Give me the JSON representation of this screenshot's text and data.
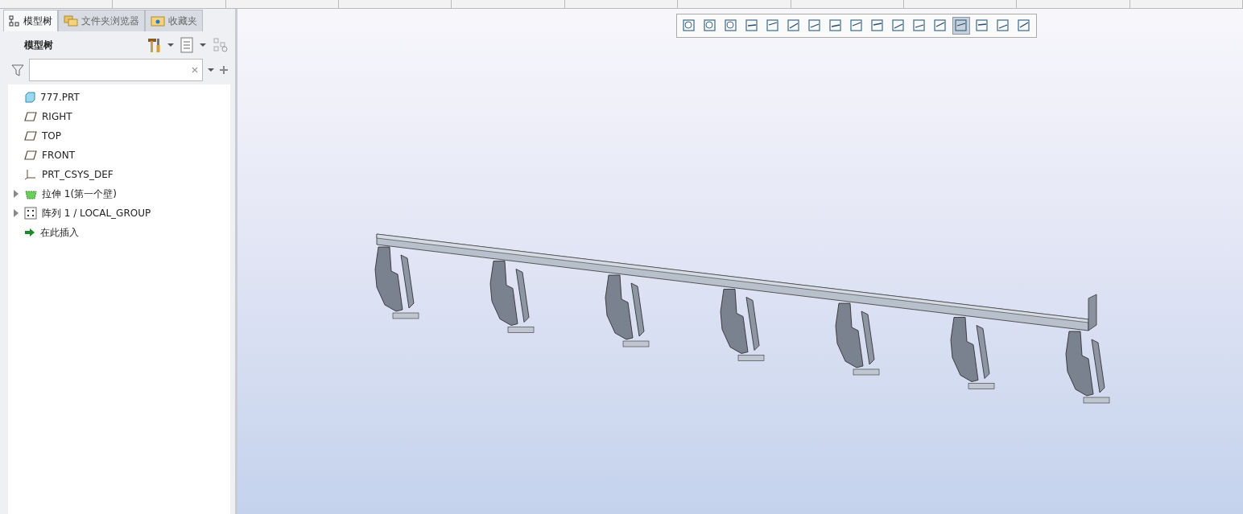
{
  "tabs": [
    {
      "label": "模型树",
      "kind": "tree",
      "selected": true
    },
    {
      "label": "文件夹浏览器",
      "kind": "folders",
      "selected": false
    },
    {
      "label": "收藏夹",
      "kind": "favorites",
      "selected": false
    }
  ],
  "panel": {
    "title": "模型树"
  },
  "tree": [
    {
      "label": "777.PRT",
      "kind": "part",
      "children": [
        {
          "label": "RIGHT",
          "kind": "plane"
        },
        {
          "label": "TOP",
          "kind": "plane"
        },
        {
          "label": "FRONT",
          "kind": "plane"
        },
        {
          "label": "PRT_CSYS_DEF",
          "kind": "csys"
        },
        {
          "label": "拉伸 1(第一个壁)",
          "kind": "extrude",
          "expanded": false
        },
        {
          "label": "阵列 1 / LOCAL_GROUP",
          "kind": "pattern",
          "expanded": false
        },
        {
          "label": "在此插入",
          "kind": "insert"
        }
      ]
    }
  ],
  "view_toolbar": [
    {
      "selected": false
    },
    {
      "selected": false
    },
    {
      "selected": false
    },
    {
      "selected": false
    },
    {
      "selected": false
    },
    {
      "selected": false
    },
    {
      "selected": false
    },
    {
      "selected": false
    },
    {
      "selected": false
    },
    {
      "selected": false
    },
    {
      "selected": false
    },
    {
      "selected": false
    },
    {
      "selected": false
    },
    {
      "selected": true
    },
    {
      "selected": false
    },
    {
      "selected": false
    },
    {
      "selected": false
    }
  ]
}
